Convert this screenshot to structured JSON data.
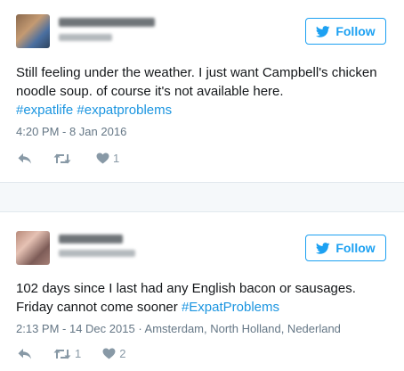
{
  "colors": {
    "accent": "#1da1f2",
    "hashtag": "#1b95e0",
    "meta_text": "#657786",
    "action_icons": "#8899a6",
    "separator_bg": "#f5f8fa"
  },
  "tweets": [
    {
      "follow_label": "Follow",
      "text_plain": "Still feeling under the weather. I just want Campbell's chicken noodle soup. of course it's not available here.",
      "hashtags": [
        "#expatlife",
        "#expatproblems"
      ],
      "timestamp": "4:20 PM - 8 Jan 2016",
      "location": "",
      "retweet_count": "",
      "like_count": "1",
      "icons": [
        "reply-icon",
        "retweet-icon",
        "heart-icon",
        "twitter-bird-icon"
      ]
    },
    {
      "follow_label": "Follow",
      "text_plain": "102 days since I last had any English bacon or sausages. Friday cannot come sooner",
      "hashtags": [
        "#ExpatProblems"
      ],
      "timestamp": "2:13 PM - 14 Dec 2015",
      "location": " · Amsterdam, North Holland, Nederland",
      "retweet_count": "1",
      "like_count": "2",
      "icons": [
        "reply-icon",
        "retweet-icon",
        "heart-icon",
        "twitter-bird-icon"
      ]
    }
  ]
}
